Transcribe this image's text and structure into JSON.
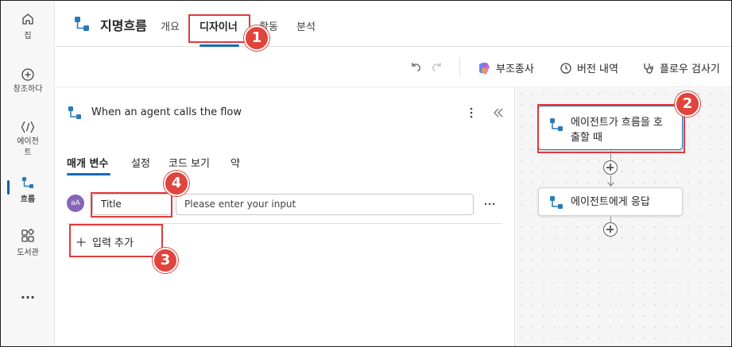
{
  "rail": {
    "items": [
      {
        "label": "집",
        "icon": "home-icon"
      },
      {
        "label": "창조하다",
        "icon": "add-circle-icon"
      },
      {
        "label": "에이전트",
        "icon": "agent-icon"
      },
      {
        "label": "흐름",
        "icon": "flow-icon"
      },
      {
        "label": "도서관",
        "icon": "library-icon"
      },
      {
        "label": "...",
        "icon": "more-icon"
      }
    ]
  },
  "header": {
    "title": "지명흐름",
    "tabs": [
      "개요",
      "디자이너",
      "활동",
      "분석"
    ]
  },
  "toolbar": {
    "copilot_label": "부조종사",
    "version_history_label": "버전 내역",
    "flow_checker_label": "플로우 검사기"
  },
  "panel": {
    "title": "When an agent calls the flow",
    "subtabs": [
      "매개 변수",
      "설정",
      "코드 보기",
      "약"
    ],
    "input_row": {
      "avatar": "aA",
      "name_value": "Title",
      "value_placeholder": "Please enter your input"
    },
    "add_input_label": "입력 추가"
  },
  "canvas": {
    "trigger_node_label": "에이전트가 흐름을 호출할 때",
    "trigger_node_line1": "에이전트가 흐름을 호",
    "trigger_node_line2": "출할 때",
    "response_node_label": "에이전트에게 응답"
  },
  "callouts": [
    "1",
    "2",
    "3",
    "4"
  ],
  "colors": {
    "accent": "#0f6cbd",
    "callout": "#e0443c",
    "flow_icon": "#2a7ab8"
  }
}
